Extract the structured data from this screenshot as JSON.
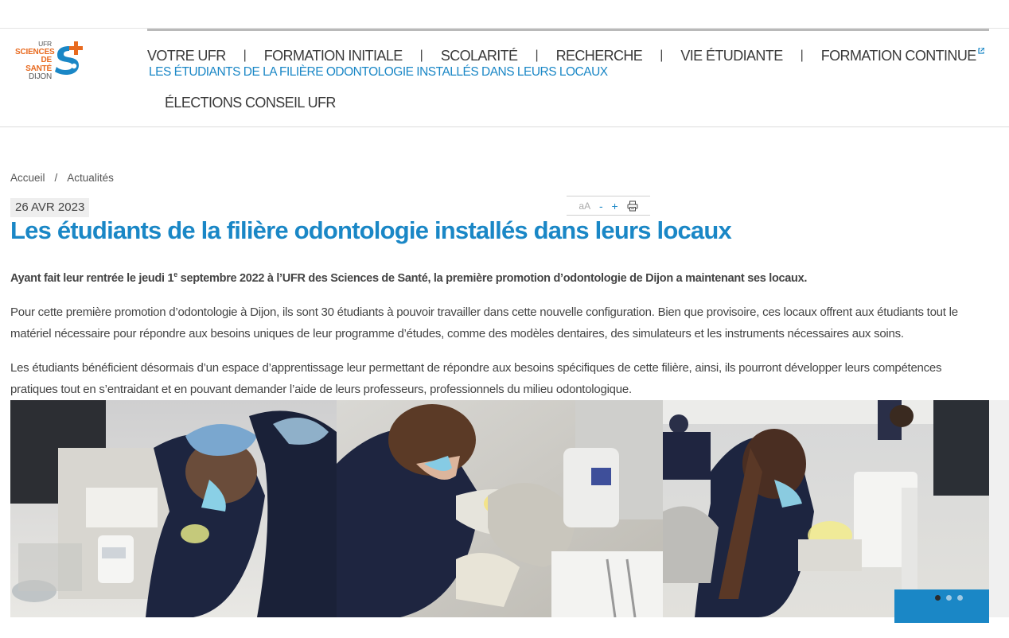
{
  "logo": {
    "line1": "UFR",
    "line2": "SCIENCES",
    "line3": "DE SANTÉ",
    "line4": "DIJON",
    "colors": {
      "orange": "#e86a1f",
      "blue": "#1a87c6"
    }
  },
  "nav": {
    "items": [
      {
        "label": "VOTRE UFR"
      },
      {
        "label": "FORMATION INITIALE"
      },
      {
        "label": "SCOLARITÉ"
      },
      {
        "label": "RECHERCHE"
      },
      {
        "label": "VIE ÉTUDIANTE"
      },
      {
        "label": "FORMATION CONTINUE",
        "external": true
      }
    ],
    "separator": "|",
    "current_label": "LES ÉTUDIANTS DE LA FILIÈRE ODONTOLOGIE INSTALLÉS DANS LEURS LOCAUX",
    "second_row_label": "ÉLECTIONS CONSEIL UFR",
    "external_icon": "external-link-icon"
  },
  "breadcrumb": {
    "home": "Accueil",
    "separator": "/",
    "current": "Actualités"
  },
  "article": {
    "date": "26 AVR 2023",
    "tools": {
      "font_label": "aA",
      "decrease": "-",
      "increase": "+",
      "print_icon": "printer-icon"
    },
    "title": "Les étudiants de la filière odontologie installés dans leurs locaux",
    "lead_before": "Ayant fait leur rentrée le jeudi 1",
    "lead_sup": "e",
    "lead_after": " septembre 2022 à l’UFR des Sciences de Santé, la première promotion d’odontologie de Dijon a maintenant ses locaux.",
    "paragraph1": "Pour cette première promotion d’odontologie à Dijon, ils sont 30 étudiants à pouvoir travailler dans cette nouvelle configuration. Bien que provisoire, ces locaux offrent aux étudiants tout le matériel nécessaire pour répondre aux besoins uniques de leur programme d’études, comme des modèles dentaires, des simulateurs et les instruments nécessaires aux soins.",
    "paragraph2": "Les étudiants bénéficient désormais d’un espace d’apprentissage leur permettant de répondre aux besoins spécifiques de cette filière, ainsi, ils pourront développer leurs compétences pratiques tout en s’entraidant et en pouvant demander l’aide de leurs professeurs, professionnels du milieu odontologique."
  },
  "gallery": {
    "photos": [
      "student-dental-simulator-photo",
      "student-dental-practice-photo",
      "student-dental-work-photo"
    ],
    "dots": 3,
    "active_dot": 1,
    "accent": "#1a87c6"
  }
}
